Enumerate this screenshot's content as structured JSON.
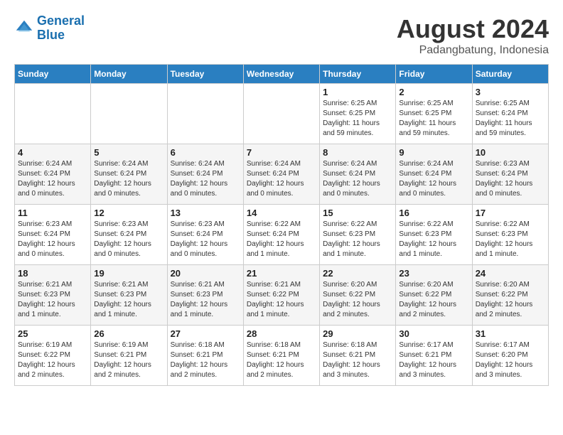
{
  "header": {
    "logo_line1": "General",
    "logo_line2": "Blue",
    "main_title": "August 2024",
    "subtitle": "Padangbatung, Indonesia"
  },
  "calendar": {
    "days_of_week": [
      "Sunday",
      "Monday",
      "Tuesday",
      "Wednesday",
      "Thursday",
      "Friday",
      "Saturday"
    ],
    "weeks": [
      [
        {
          "day": "",
          "sunrise": "",
          "sunset": "",
          "daylight": ""
        },
        {
          "day": "",
          "sunrise": "",
          "sunset": "",
          "daylight": ""
        },
        {
          "day": "",
          "sunrise": "",
          "sunset": "",
          "daylight": ""
        },
        {
          "day": "",
          "sunrise": "",
          "sunset": "",
          "daylight": ""
        },
        {
          "day": "1",
          "sunrise": "Sunrise: 6:25 AM",
          "sunset": "Sunset: 6:25 PM",
          "daylight": "Daylight: 11 hours and 59 minutes."
        },
        {
          "day": "2",
          "sunrise": "Sunrise: 6:25 AM",
          "sunset": "Sunset: 6:25 PM",
          "daylight": "Daylight: 11 hours and 59 minutes."
        },
        {
          "day": "3",
          "sunrise": "Sunrise: 6:25 AM",
          "sunset": "Sunset: 6:24 PM",
          "daylight": "Daylight: 11 hours and 59 minutes."
        }
      ],
      [
        {
          "day": "4",
          "sunrise": "Sunrise: 6:24 AM",
          "sunset": "Sunset: 6:24 PM",
          "daylight": "Daylight: 12 hours and 0 minutes."
        },
        {
          "day": "5",
          "sunrise": "Sunrise: 6:24 AM",
          "sunset": "Sunset: 6:24 PM",
          "daylight": "Daylight: 12 hours and 0 minutes."
        },
        {
          "day": "6",
          "sunrise": "Sunrise: 6:24 AM",
          "sunset": "Sunset: 6:24 PM",
          "daylight": "Daylight: 12 hours and 0 minutes."
        },
        {
          "day": "7",
          "sunrise": "Sunrise: 6:24 AM",
          "sunset": "Sunset: 6:24 PM",
          "daylight": "Daylight: 12 hours and 0 minutes."
        },
        {
          "day": "8",
          "sunrise": "Sunrise: 6:24 AM",
          "sunset": "Sunset: 6:24 PM",
          "daylight": "Daylight: 12 hours and 0 minutes."
        },
        {
          "day": "9",
          "sunrise": "Sunrise: 6:24 AM",
          "sunset": "Sunset: 6:24 PM",
          "daylight": "Daylight: 12 hours and 0 minutes."
        },
        {
          "day": "10",
          "sunrise": "Sunrise: 6:23 AM",
          "sunset": "Sunset: 6:24 PM",
          "daylight": "Daylight: 12 hours and 0 minutes."
        }
      ],
      [
        {
          "day": "11",
          "sunrise": "Sunrise: 6:23 AM",
          "sunset": "Sunset: 6:24 PM",
          "daylight": "Daylight: 12 hours and 0 minutes."
        },
        {
          "day": "12",
          "sunrise": "Sunrise: 6:23 AM",
          "sunset": "Sunset: 6:24 PM",
          "daylight": "Daylight: 12 hours and 0 minutes."
        },
        {
          "day": "13",
          "sunrise": "Sunrise: 6:23 AM",
          "sunset": "Sunset: 6:24 PM",
          "daylight": "Daylight: 12 hours and 0 minutes."
        },
        {
          "day": "14",
          "sunrise": "Sunrise: 6:22 AM",
          "sunset": "Sunset: 6:24 PM",
          "daylight": "Daylight: 12 hours and 1 minute."
        },
        {
          "day": "15",
          "sunrise": "Sunrise: 6:22 AM",
          "sunset": "Sunset: 6:23 PM",
          "daylight": "Daylight: 12 hours and 1 minute."
        },
        {
          "day": "16",
          "sunrise": "Sunrise: 6:22 AM",
          "sunset": "Sunset: 6:23 PM",
          "daylight": "Daylight: 12 hours and 1 minute."
        },
        {
          "day": "17",
          "sunrise": "Sunrise: 6:22 AM",
          "sunset": "Sunset: 6:23 PM",
          "daylight": "Daylight: 12 hours and 1 minute."
        }
      ],
      [
        {
          "day": "18",
          "sunrise": "Sunrise: 6:21 AM",
          "sunset": "Sunset: 6:23 PM",
          "daylight": "Daylight: 12 hours and 1 minute."
        },
        {
          "day": "19",
          "sunrise": "Sunrise: 6:21 AM",
          "sunset": "Sunset: 6:23 PM",
          "daylight": "Daylight: 12 hours and 1 minute."
        },
        {
          "day": "20",
          "sunrise": "Sunrise: 6:21 AM",
          "sunset": "Sunset: 6:23 PM",
          "daylight": "Daylight: 12 hours and 1 minute."
        },
        {
          "day": "21",
          "sunrise": "Sunrise: 6:21 AM",
          "sunset": "Sunset: 6:22 PM",
          "daylight": "Daylight: 12 hours and 1 minute."
        },
        {
          "day": "22",
          "sunrise": "Sunrise: 6:20 AM",
          "sunset": "Sunset: 6:22 PM",
          "daylight": "Daylight: 12 hours and 2 minutes."
        },
        {
          "day": "23",
          "sunrise": "Sunrise: 6:20 AM",
          "sunset": "Sunset: 6:22 PM",
          "daylight": "Daylight: 12 hours and 2 minutes."
        },
        {
          "day": "24",
          "sunrise": "Sunrise: 6:20 AM",
          "sunset": "Sunset: 6:22 PM",
          "daylight": "Daylight: 12 hours and 2 minutes."
        }
      ],
      [
        {
          "day": "25",
          "sunrise": "Sunrise: 6:19 AM",
          "sunset": "Sunset: 6:22 PM",
          "daylight": "Daylight: 12 hours and 2 minutes."
        },
        {
          "day": "26",
          "sunrise": "Sunrise: 6:19 AM",
          "sunset": "Sunset: 6:21 PM",
          "daylight": "Daylight: 12 hours and 2 minutes."
        },
        {
          "day": "27",
          "sunrise": "Sunrise: 6:18 AM",
          "sunset": "Sunset: 6:21 PM",
          "daylight": "Daylight: 12 hours and 2 minutes."
        },
        {
          "day": "28",
          "sunrise": "Sunrise: 6:18 AM",
          "sunset": "Sunset: 6:21 PM",
          "daylight": "Daylight: 12 hours and 2 minutes."
        },
        {
          "day": "29",
          "sunrise": "Sunrise: 6:18 AM",
          "sunset": "Sunset: 6:21 PM",
          "daylight": "Daylight: 12 hours and 3 minutes."
        },
        {
          "day": "30",
          "sunrise": "Sunrise: 6:17 AM",
          "sunset": "Sunset: 6:21 PM",
          "daylight": "Daylight: 12 hours and 3 minutes."
        },
        {
          "day": "31",
          "sunrise": "Sunrise: 6:17 AM",
          "sunset": "Sunset: 6:20 PM",
          "daylight": "Daylight: 12 hours and 3 minutes."
        }
      ]
    ]
  }
}
